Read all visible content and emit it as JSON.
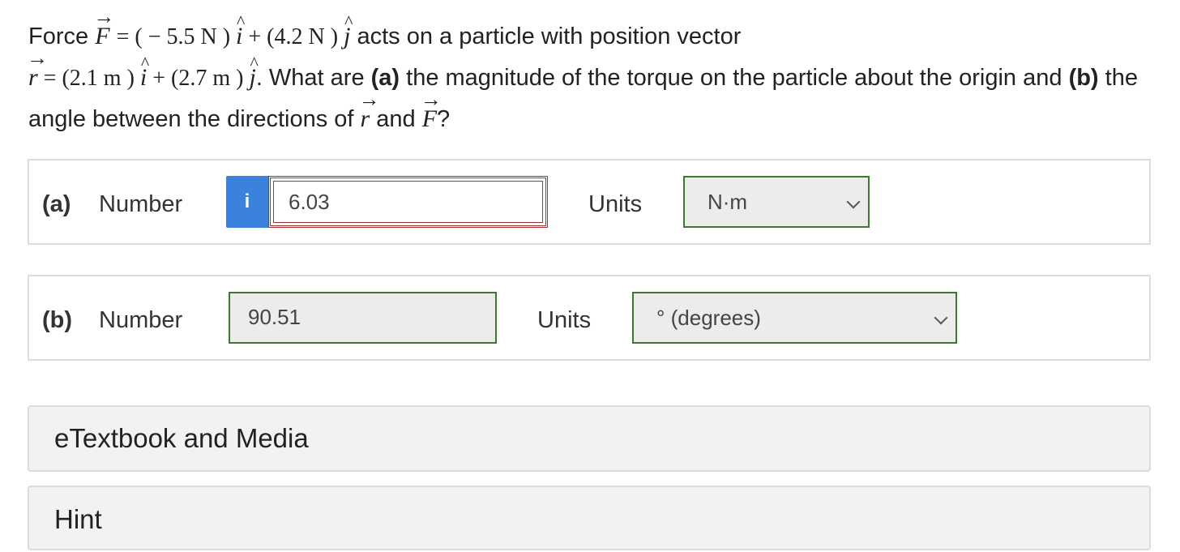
{
  "question": {
    "t_force": "Force",
    "F_sym": "F",
    "eq1": "= ( − 5.5 N ) ",
    "i_sym": "i",
    "plus": " + (4.2 N ) ",
    "j_sym": "j",
    "t_acts": " acts on a particle with position vector",
    "r_sym": "r",
    "eq2": " = (2.1 m ) ",
    "plus2": " + (2.7 m ) ",
    "t_what": ". What are ",
    "a_mark": "(a)",
    "t_mag": " the magnitude of the torque on the particle about the origin and ",
    "b_mark": "(b)",
    "t_angle": " the angle between the directions of ",
    "t_and": " and ",
    "t_q": "?"
  },
  "part_a": {
    "label": "(a)",
    "number_label": "Number",
    "info_icon": "i",
    "value": "6.03",
    "units_label": "Units",
    "units_value": "N·m"
  },
  "part_b": {
    "label": "(b)",
    "number_label": "Number",
    "value": "90.51",
    "units_label": "Units",
    "units_value": "° (degrees)"
  },
  "panels": {
    "etextbook": "eTextbook and Media",
    "hint": "Hint"
  },
  "colors": {
    "info_blue": "#3b82df",
    "wrong_red": "#a83232",
    "correct_green": "#3c7a2f"
  }
}
